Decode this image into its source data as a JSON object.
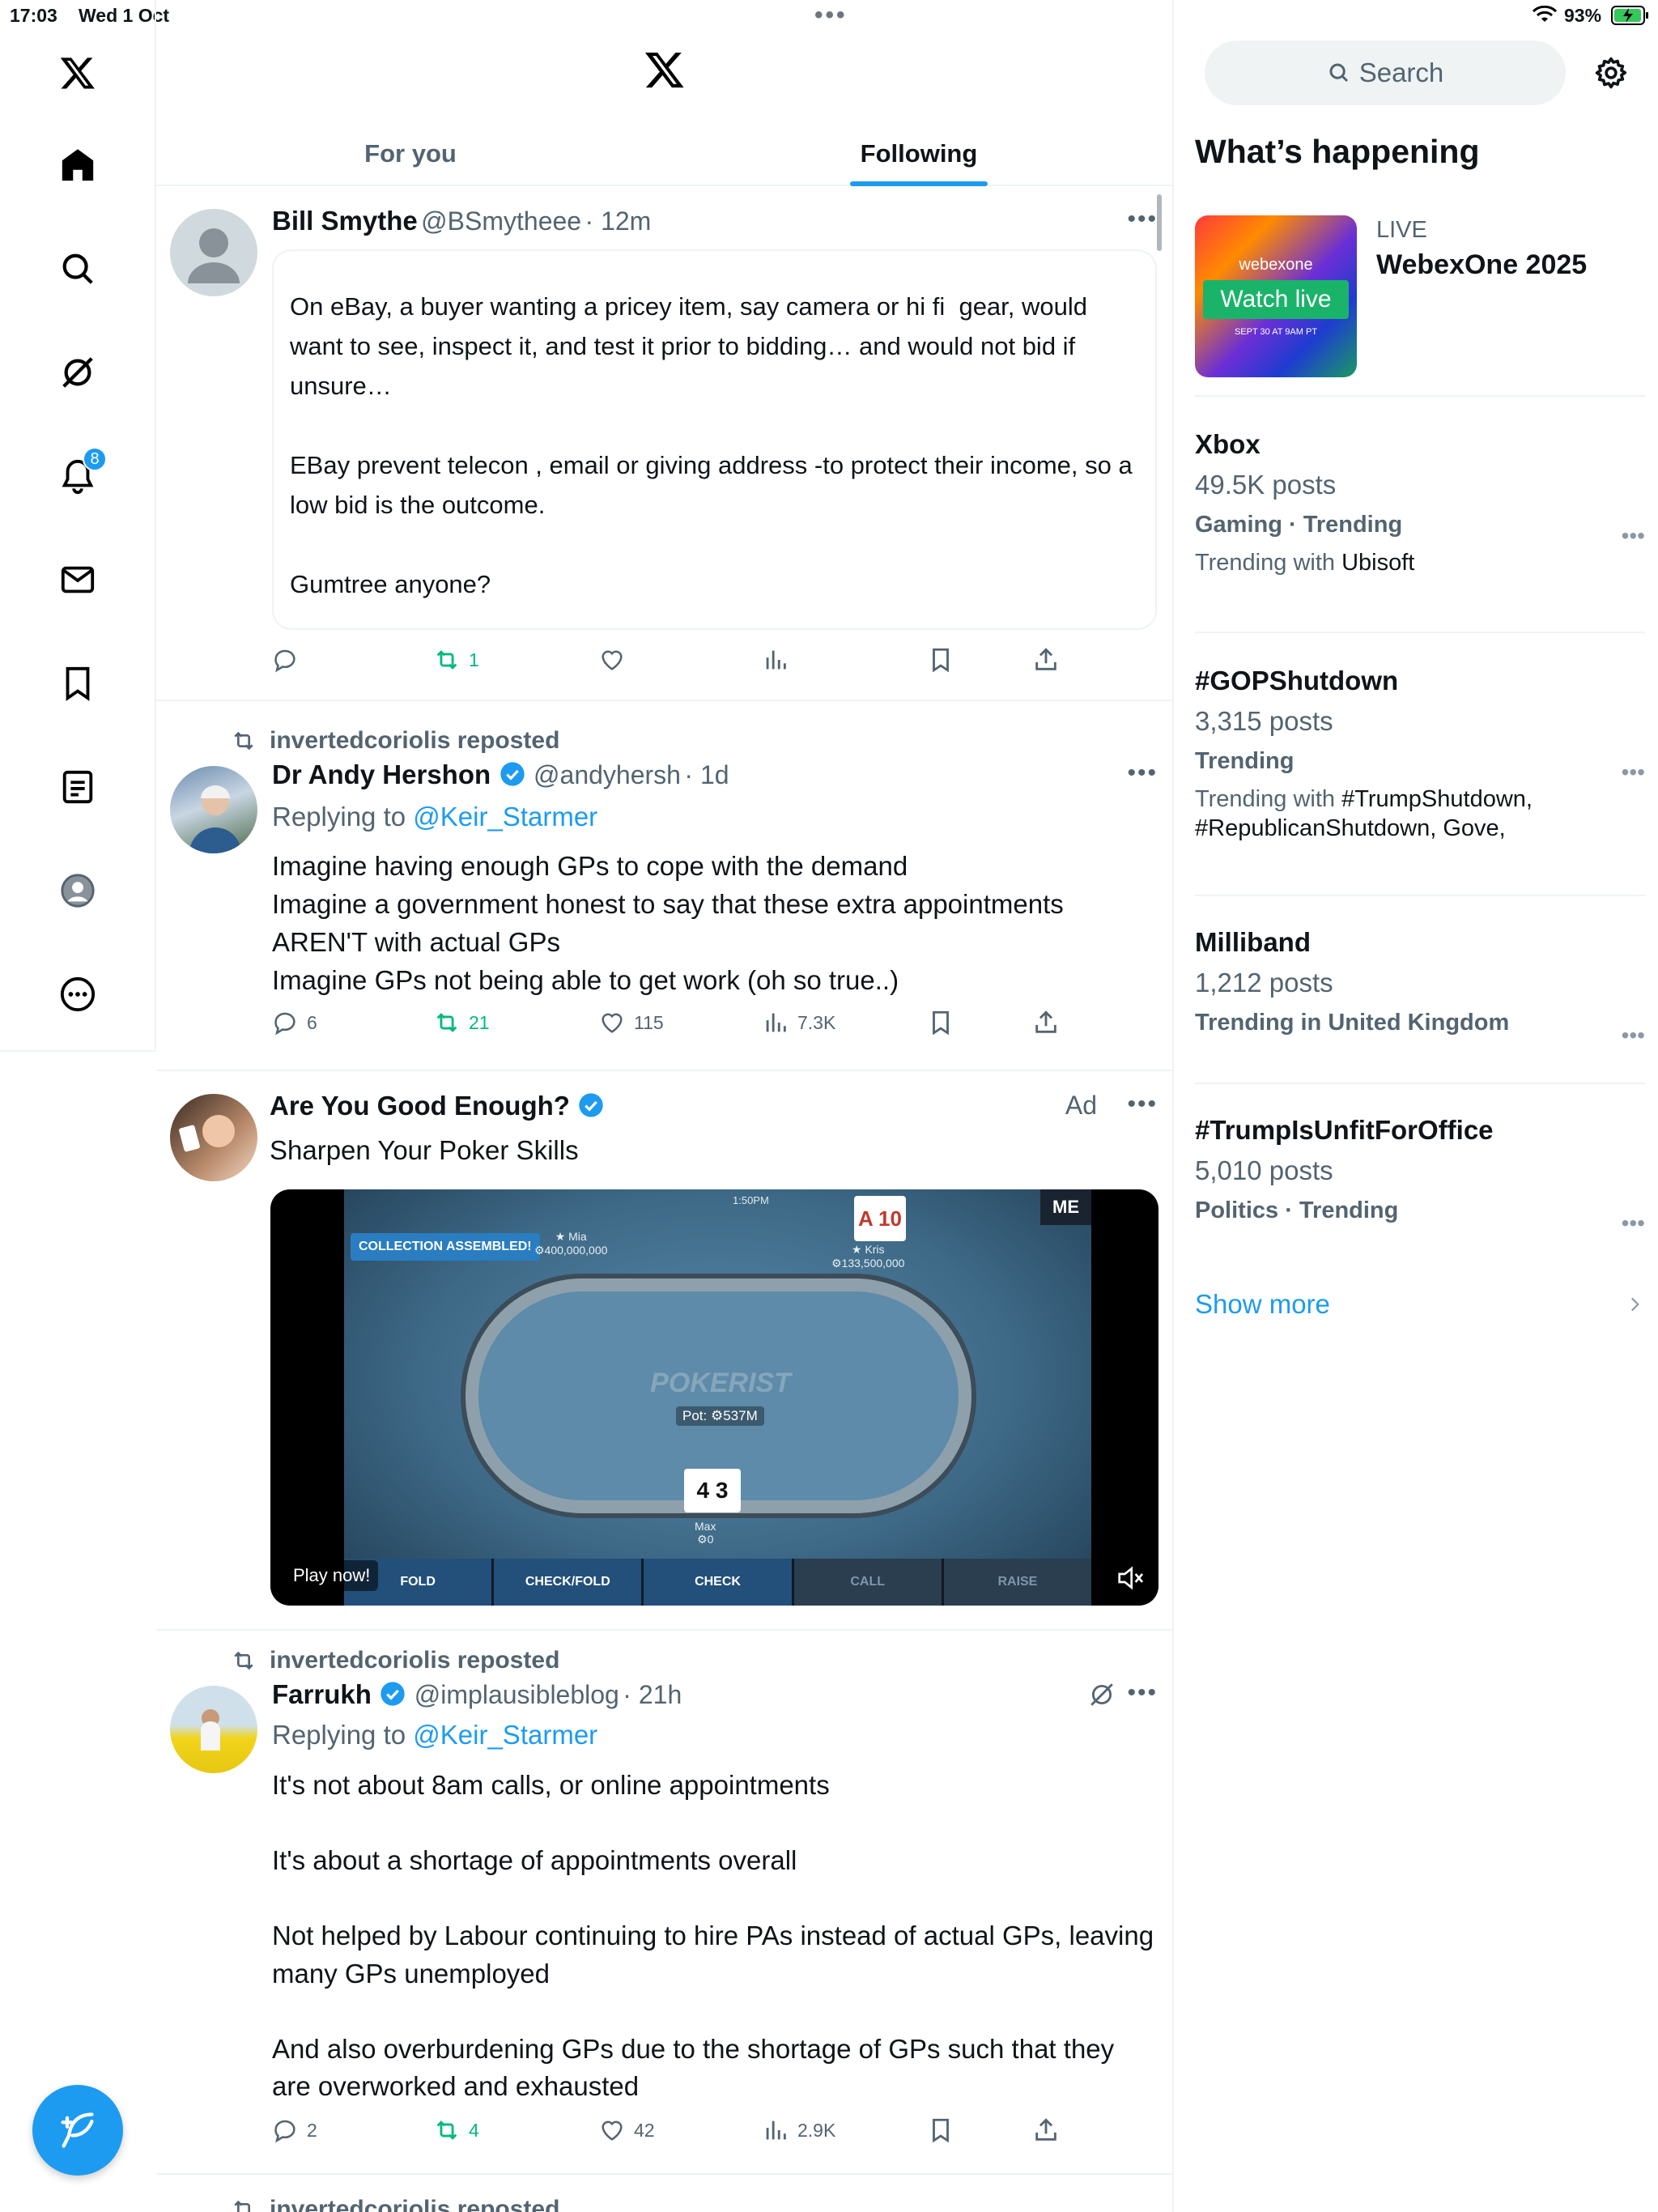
{
  "status_bar": {
    "time": "17:03",
    "date": "Wed 1 Oct",
    "battery": "93%"
  },
  "nav": {
    "notifications_badge": "8"
  },
  "header": {
    "tabs": [
      {
        "label": "For you",
        "active": false
      },
      {
        "label": "Following",
        "active": true
      }
    ]
  },
  "posts": [
    {
      "name": "Bill Smythe",
      "handle": "@BSmytheee",
      "time": "· 12m",
      "text": "On eBay, a buyer wanting a pricey item, say camera or hi fi  gear, would want to see, inspect it, and test it prior to bidding… and would not bid if unsure…\n\nEBay prevent telecon , email or giving address -to protect their income, so a low bid is the outcome.\n\nGumtree anyone?",
      "stats": {
        "replies": "",
        "reposts": "1",
        "likes": "",
        "views": ""
      }
    },
    {
      "reposted_by": "invertedcoriolis reposted",
      "name": "Dr Andy Hershon",
      "handle": "@andyhersh",
      "time": "· 1d",
      "replying_prefix": "Replying to ",
      "replying_to": "@Keir_Starmer",
      "text": "Imagine having enough GPs to cope with the demand\nImagine a government honest to say that these extra appointments AREN'T with actual GPs\nImagine GPs not being able to get work (oh so true..)",
      "stats": {
        "replies": "6",
        "reposts": "21",
        "likes": "115",
        "views": "7.3K"
      }
    },
    {
      "name": "Are You Good Enough?",
      "ad_label": "Ad",
      "text": "Sharpen Your Poker Skills",
      "video": {
        "play_label": "Play now!",
        "collection_banner": "COLLECTION ASSEMBLED!",
        "brand": "POKERIST",
        "pot": "Pot: ⚙537M",
        "time": "1:50PM",
        "corner_label": "ME",
        "player_left": {
          "name": "★ Mia",
          "chips": "⚙400,000,000"
        },
        "player_right": {
          "name": "★ Kris",
          "chips": "⚙133,500,000",
          "cards": "A 10"
        },
        "player_bottom": {
          "name": "Max",
          "chips": "⚙0",
          "cards": "4 3"
        },
        "buttons": [
          "FOLD",
          "CHECK/FOLD",
          "CHECK",
          "CALL",
          "RAISE"
        ]
      }
    },
    {
      "reposted_by": "invertedcoriolis reposted",
      "name": "Farrukh",
      "handle": "@implausibleblog",
      "time": "· 21h",
      "replying_prefix": "Replying to ",
      "replying_to": "@Keir_Starmer",
      "text": "It's not about 8am calls, or online appointments\n\nIt's about a shortage of appointments overall\n\nNot helped by Labour continuing to hire PAs instead of actual GPs, leaving many GPs unemployed\n\nAnd also overburdening GPs due to the shortage of GPs such that they are overworked and exhausted",
      "stats": {
        "replies": "2",
        "reposts": "4",
        "likes": "42",
        "views": "2.9K"
      }
    },
    {
      "reposted_by": "invertedcoriolis reposted"
    }
  ],
  "sidebar": {
    "search_placeholder": "Search",
    "section_title": "What’s happening",
    "live": {
      "tag": "LIVE",
      "title": "WebexOne 2025",
      "image_brand": "webexone",
      "image_cta": "Watch live",
      "image_date": "SEPT 30 AT 9AM PT"
    },
    "trends": [
      {
        "title": "Xbox",
        "count": "49.5K posts",
        "category": "Gaming · Trending",
        "with_prefix": "Trending with ",
        "with": "Ubisoft"
      },
      {
        "title": "#GOPShutdown",
        "count": "3,315 posts",
        "category": "Trending",
        "with_prefix": "Trending with ",
        "with": "#TrumpShutdown, #RepublicanShutdown, Gove,"
      },
      {
        "title": "Milliband",
        "count": "1,212 posts",
        "category": "Trending in United Kingdom"
      },
      {
        "title": "#TrumpIsUnfitForOffice",
        "count": "5,010 posts",
        "category": "Politics · Trending"
      }
    ],
    "show_more": "Show more"
  },
  "colors": {
    "accent": "#1d9bf0",
    "repost_green": "#00ba7c",
    "text_secondary": "#536471"
  }
}
